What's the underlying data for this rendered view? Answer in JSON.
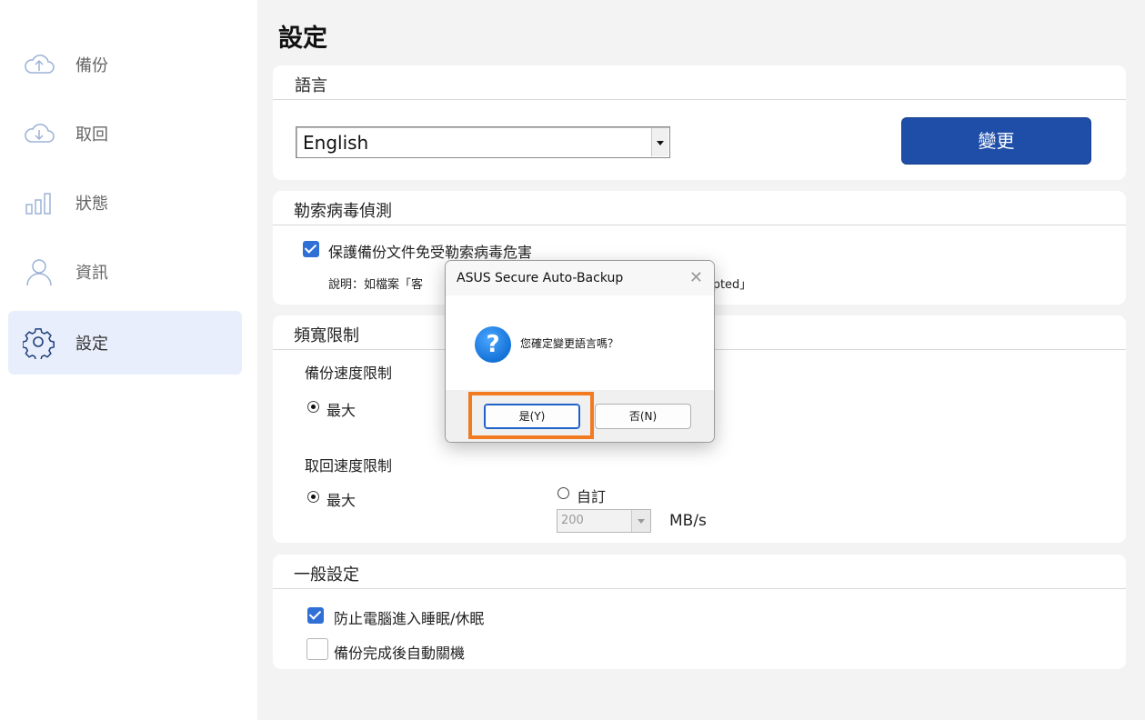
{
  "sidebar": {
    "items": [
      {
        "label": "備份",
        "icon": "cloud-upload-icon"
      },
      {
        "label": "取回",
        "icon": "cloud-download-icon"
      },
      {
        "label": "狀態",
        "icon": "bar-chart-icon"
      },
      {
        "label": "資訊",
        "icon": "user-icon"
      },
      {
        "label": "設定",
        "icon": "gear-icon",
        "active": true
      }
    ]
  },
  "page": {
    "title": "設定"
  },
  "language": {
    "section_title": "語言",
    "selected": "English",
    "change_button": "變更"
  },
  "ransomware": {
    "section_title": "勒索病毒偵測",
    "protect_label": "保護備份文件免受勒索病毒危害",
    "protect_checked": true,
    "note_prefix": "說明：如檔案「客",
    "note_suffix": "ypted」"
  },
  "bandwidth": {
    "section_title": "頻寬限制",
    "backup_label": "備份速度限制",
    "backup_max": "最大",
    "restore_label": "取回速度限制",
    "restore_max": "最大",
    "restore_custom": "自訂",
    "restore_value": "200",
    "unit": "MB/s"
  },
  "general": {
    "section_title": "一般設定",
    "prevent_sleep": "防止電腦進入睡眠/休眠",
    "prevent_sleep_checked": true,
    "auto_shutdown": "備份完成後自動關機",
    "auto_shutdown_checked": false
  },
  "dialog": {
    "title": "ASUS Secure Auto-Backup",
    "close": "✕",
    "icon": "question-icon",
    "message": "您確定變更語言嗎？",
    "yes": "是(Y)",
    "no": "否(N)"
  },
  "colors": {
    "accent": "#1f4ea8",
    "highlight": "#f27b21",
    "checkbox": "#2f6fd6"
  }
}
